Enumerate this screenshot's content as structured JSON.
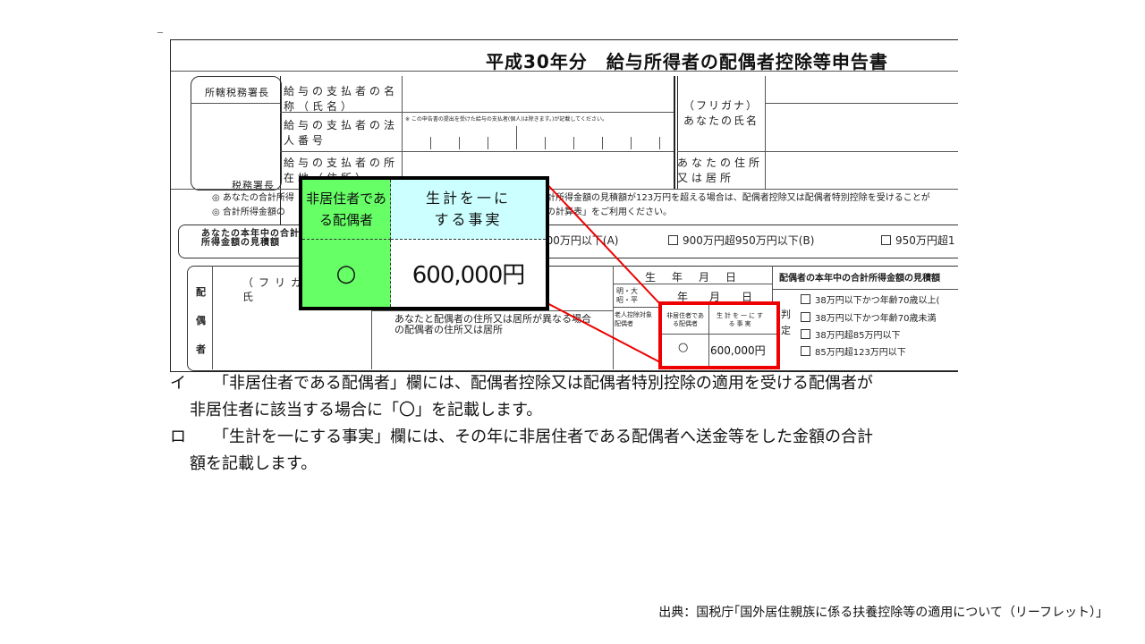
{
  "form": {
    "title": "平成30年分　給与所得者の配偶者控除等申告書",
    "office_label": "所轄税務署長",
    "tax_office_label": "税務署長",
    "payer_name_label": "給与の支払者の名称（氏名）",
    "payer_number_label": "給与の支払者の法人番号",
    "payer_number_note": "※ この申告書の提出を受けた給与の支払者(個人)は除きます。)が記載してください。",
    "payer_address_label": "給与の支払者の所在地（住所）",
    "furigana_name_label": "（フリガナ）あなたの氏名",
    "your_address_label": "あなたの住所又は居所",
    "note_line1": "◎ あなたの合計所得",
    "note_line1_right": "計所得金額の見積額が123万円を超える場合は、配偶者控除又は配偶者特別控除を受けることが",
    "note_line2": "◎ 合計所得金額の",
    "note_line2_right": "の計算表」をご利用ください。",
    "income_label": "あなたの本年中の合計所得金額の見積額",
    "income_options": [
      "900万円以下(A)",
      "900万円超950万円以下(B)",
      "950万円超1"
    ],
    "spouse_label": "配偶者",
    "spouse_furigana": "（フリガナ）",
    "spouse_name": "氏",
    "birth_label": "生年月日",
    "birth_era": "明・大 昭・平",
    "birth_ymd": "年　月　日",
    "address_diff_label": "あなたと配偶者の住所又は居所が異なる場合の配偶者の住所又は居所",
    "elderly_label": "老人控除対象配偶者",
    "small_nonres_header": "非居住者である配偶者",
    "small_livelihood_header": "生計を一にする事実",
    "small_circle": "○",
    "small_amount": "600,000円",
    "estimate_header": "配偶者の本年中の合計所得金額の見積額",
    "judgement_label": "判定",
    "estimate_options": [
      "38万円以下かつ年齢70歳以上(",
      "38万円以下かつ年齢70歳未満",
      "38万円超85万円以下",
      "85万円超123万円以下"
    ]
  },
  "callout": {
    "nonresident_header": "非居住者である配偶者",
    "livelihood_header": "生計を一にする事実",
    "circle_mark": "○",
    "amount": "600,000円",
    "colors": {
      "green": "#66ff66",
      "cyan": "#ccffff",
      "highlight": "#ee0000"
    }
  },
  "explanation": {
    "item_a_marker": "イ",
    "item_a_line1": "「非居住者である配偶者」欄には、配偶者控除又は配偶者特別控除の適用を受ける配偶者が",
    "item_a_line2": "非居住者に該当する場合に「〇」を記載します。",
    "item_b_marker": "ロ",
    "item_b_line1": "「生計を一にする事実」欄には、その年に非居住者である配偶者へ送金等をした金額の合計",
    "item_b_line2": "額を記載します。"
  },
  "source": "出典：国税庁｢国外居住親族に係る扶養控除等の適用について（リーフレット）｣"
}
